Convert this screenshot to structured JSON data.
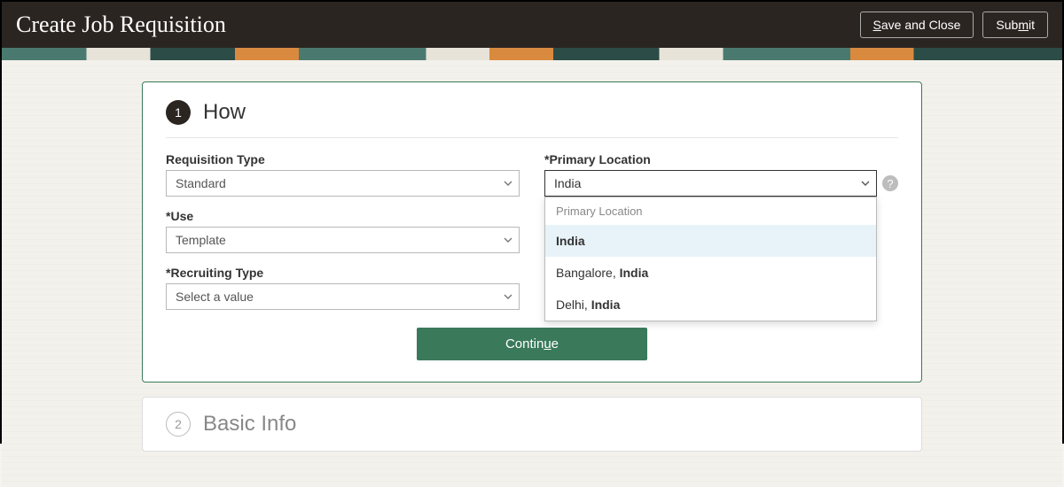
{
  "header": {
    "title": "Create Job Requisition",
    "save_label_pre": "S",
    "save_label_rest": "ave and Close",
    "submit_label_pre": "Sub",
    "submit_label_u": "m",
    "submit_label_post": "it"
  },
  "step1": {
    "number": "1",
    "title": "How",
    "fields": {
      "req_type_label": "Requisition Type",
      "req_type_value": "Standard",
      "use_label": "Use",
      "use_value": "Template",
      "rec_type_label": "Recruiting Type",
      "rec_type_value": "Select a value",
      "loc_label": "Primary Location",
      "loc_value": "India"
    },
    "dropdown": {
      "heading": "Primary Location",
      "options": [
        {
          "prefix": "",
          "match": "India",
          "suffix": "",
          "highlighted": true
        },
        {
          "prefix": "Bangalore, ",
          "match": "India",
          "suffix": "",
          "highlighted": false
        },
        {
          "prefix": "Delhi, ",
          "match": "India",
          "suffix": "",
          "highlighted": false
        }
      ]
    },
    "continue_pre": "Contin",
    "continue_u": "u",
    "continue_post": "e"
  },
  "step2": {
    "number": "2",
    "title": "Basic Info"
  },
  "help_glyph": "?"
}
